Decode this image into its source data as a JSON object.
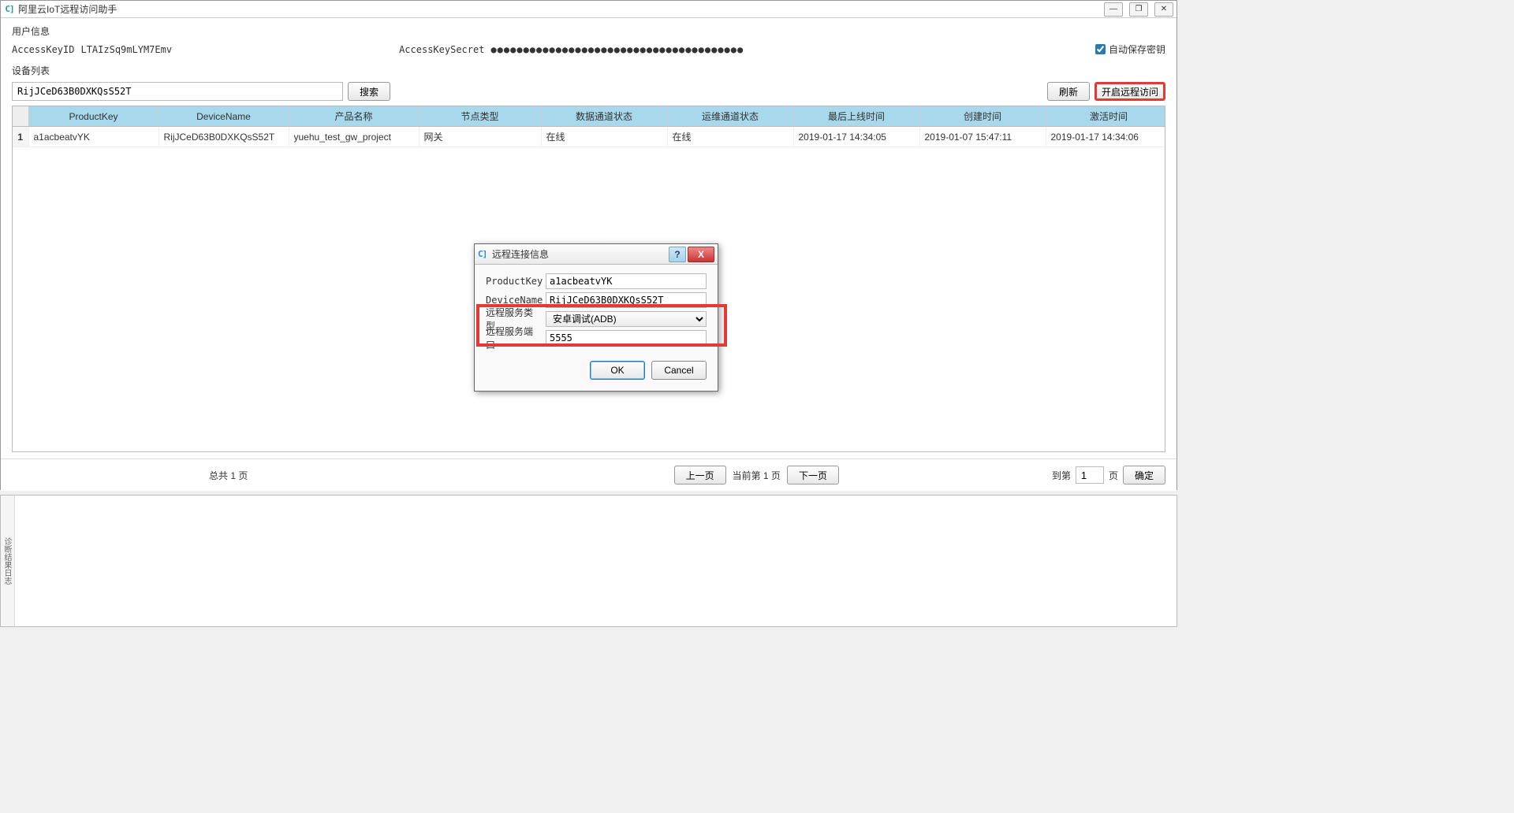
{
  "window": {
    "title": "阿里云IoT远程访问助手"
  },
  "user_info": {
    "section_label": "用户信息",
    "access_key_id_label": "AccessKeyID",
    "access_key_id_value": "LTAIzSq9mLYM7Emv",
    "access_key_secret_label": "AccessKeySecret",
    "access_key_secret_mask": "●●●●●●●●●●●●●●●●●●●●●●●●●●●●●●●●●●●●●●●",
    "auto_save_label": "自动保存密钥"
  },
  "device_list": {
    "section_label": "设备列表",
    "search_value": "RijJCeD63B0DXKQsS52T",
    "search_button": "搜索",
    "refresh_button": "刷新",
    "open_remote_button": "开启远程访问"
  },
  "table": {
    "headers": [
      "ProductKey",
      "DeviceName",
      "产品名称",
      "节点类型",
      "数据通道状态",
      "运维通道状态",
      "最后上线时间",
      "创建时间",
      "激活时间"
    ],
    "rows": [
      {
        "num": "1",
        "cells": [
          "a1acbeatvYK",
          "RijJCeD63B0DXKQsS52T",
          "yuehu_test_gw_project",
          "网关",
          "在线",
          "在线",
          "2019-01-17 14:34:05",
          "2019-01-07 15:47:11",
          "2019-01-17 14:34:06"
        ]
      }
    ]
  },
  "pager": {
    "total_label": "总共 1 页",
    "prev": "上一页",
    "current_label": "当前第 1 页",
    "next": "下一页",
    "goto_prefix": "到第",
    "goto_value": "1",
    "goto_suffix": "页",
    "confirm": "确定"
  },
  "dialog": {
    "title": "远程连接信息",
    "product_key_label": "ProductKey",
    "product_key_value": "a1acbeatvYK",
    "device_name_label": "DeviceName",
    "device_name_value": "RijJCeD63B0DXKQsS52T",
    "service_type_label": "远程服务类型",
    "service_type_value": "安卓调试(ADB)",
    "service_port_label": "远程服务端口",
    "service_port_value": "5555",
    "ok": "OK",
    "cancel": "Cancel",
    "help": "?",
    "close": "X"
  },
  "log_gutter": "诊断结果日志"
}
